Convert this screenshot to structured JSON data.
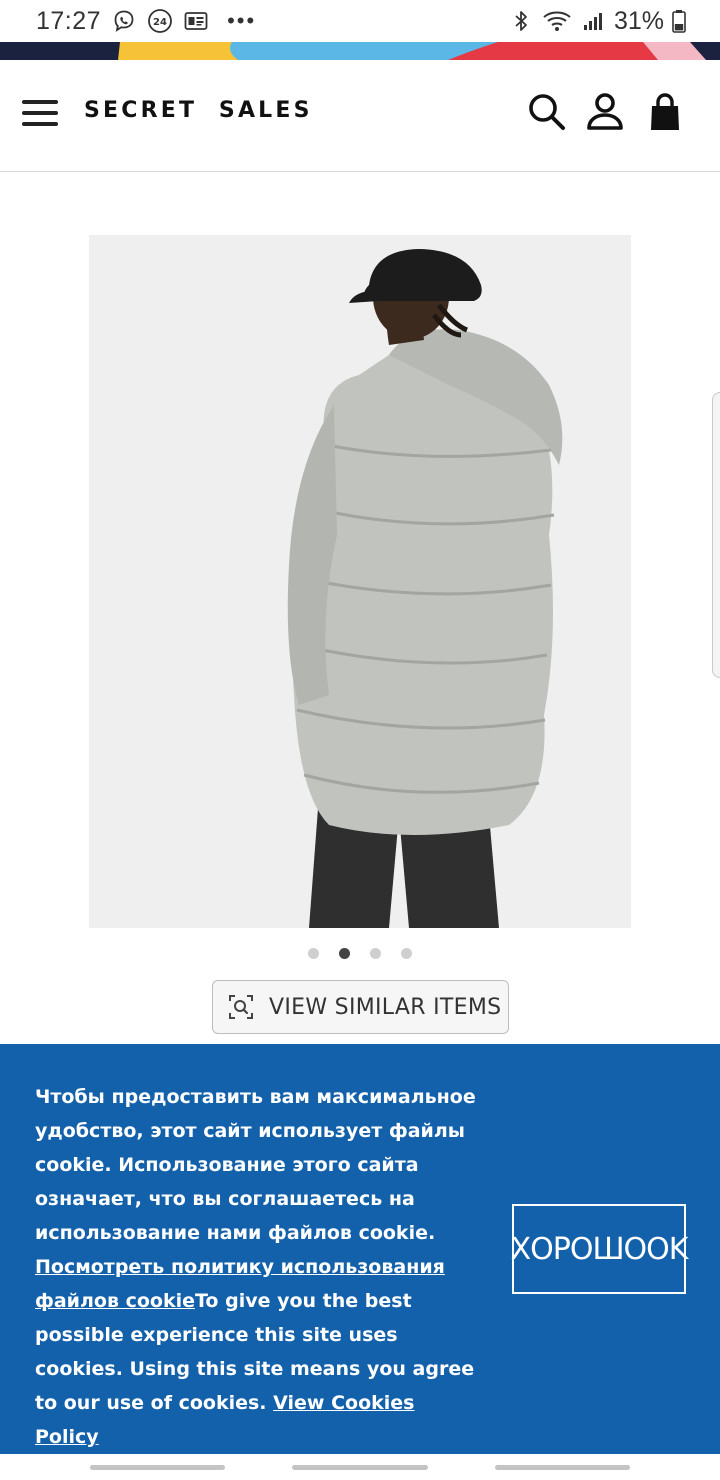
{
  "status_bar": {
    "time": "17:27",
    "badge_24": "24",
    "battery": "31%",
    "icons": [
      "viber-icon",
      "24-clock-icon",
      "gallery-icon",
      "more-dots-icon",
      "bluetooth-icon",
      "wifi-icon",
      "signal-icon",
      "battery-icon"
    ]
  },
  "brand_stripe_colors": [
    "#1a2240",
    "#f6c237",
    "#5bb8e6",
    "#e53a46",
    "#f3b8c3"
  ],
  "header": {
    "logo": "SECRET  SALES",
    "icons": [
      "hamburger-menu-icon",
      "search-icon",
      "account-icon",
      "shopping-bag-icon"
    ]
  },
  "product": {
    "image_alt": "Man wearing long grey puffer coat with hood",
    "carousel": {
      "count": 4,
      "active_index": 1
    }
  },
  "view_similar": {
    "label": "VIEW SIMILAR ITEMS",
    "icon": "visual-search-icon"
  },
  "cookie_banner": {
    "ru_text": "Чтобы предоставить вам максимальное удобство, этот сайт использует файлы cookie. Использование этого сайта означает, что вы соглашаетесь на использование нами файлов cookie.",
    "ru_link": "Посмотреть политику использования файлов cookie",
    "en_text": "To give you the best possible experience this site uses cookies. Using this site means you agree to our use of cookies.",
    "en_link": "View Cookies Policy",
    "ok_button": "ХОРОШОOK",
    "background": "#1360ab"
  }
}
